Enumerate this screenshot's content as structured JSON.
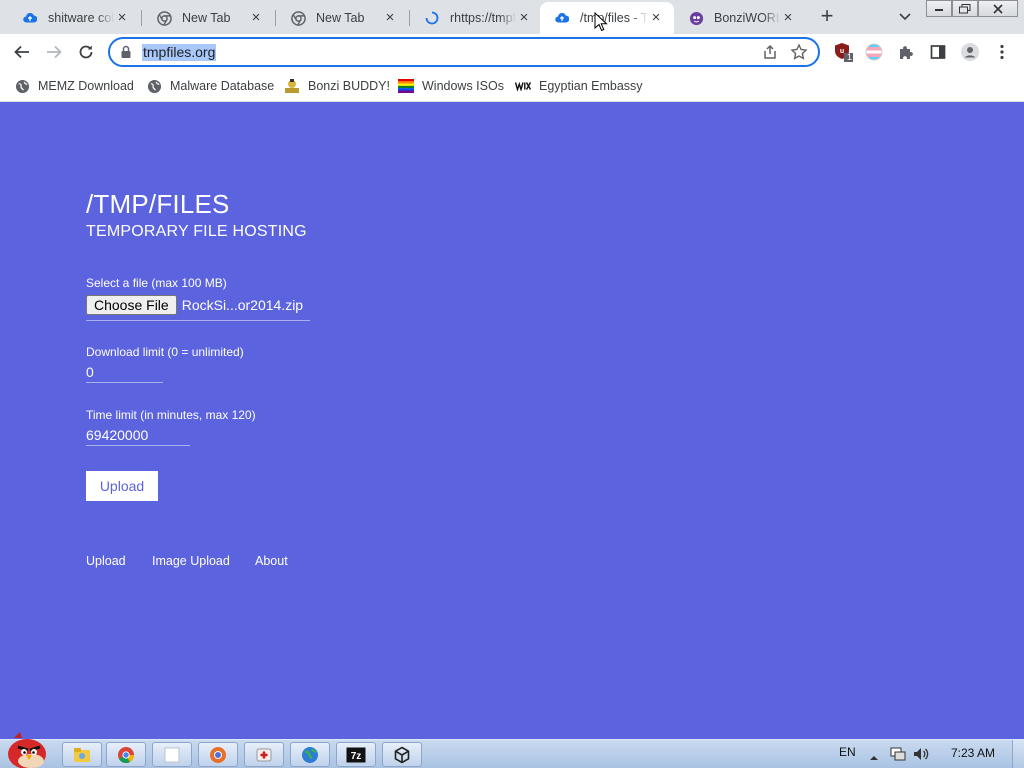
{
  "browser": {
    "tabs": [
      {
        "title": "shitware colle",
        "favicon": "cloud-upload-icon"
      },
      {
        "title": "New Tab",
        "favicon": "chrome-icon"
      },
      {
        "title": "New Tab",
        "favicon": "chrome-icon"
      },
      {
        "title": "rhttps://tmpfi",
        "favicon": "loading-spinner-icon"
      },
      {
        "title": "/tmp/files - T",
        "favicon": "cloud-upload-icon",
        "active": true
      },
      {
        "title": "BonziWORLD",
        "favicon": "bonzi-icon"
      }
    ],
    "new_tab_symbol": "+",
    "close_symbol": "×",
    "omnibox": {
      "url": "tmpfiles.org"
    },
    "bookmarks": [
      {
        "label": "MEMZ Download",
        "icon": "globe-icon"
      },
      {
        "label": "Malware Database",
        "icon": "globe-icon"
      },
      {
        "label": "Bonzi BUDDY!",
        "icon": "bonzi-icon"
      },
      {
        "label": "Windows ISOs",
        "icon": "rainbow-flag-icon"
      },
      {
        "label": "Egyptian Embassy",
        "icon": "wix-icon"
      }
    ],
    "extension_badge": "1",
    "accent_color": "#1a73e8"
  },
  "page": {
    "background_color": "#5b63df",
    "title": "/TMP/FILES",
    "subtitle": "TEMPORARY FILE HOSTING",
    "file_label": "Select a file (max 100 MB)",
    "choose_file_label": "Choose File",
    "file_name": "RockSi...or2014.zip",
    "download_limit_label": "Download limit (0 = unlimited)",
    "download_limit_value": "0",
    "time_limit_label": "Time limit (in minutes, max 120)",
    "time_limit_value": "69420000",
    "upload_button": "Upload",
    "footer_links": [
      "Upload",
      "Image Upload",
      "About"
    ]
  },
  "taskbar": {
    "language": "EN",
    "clock": "7:23 AM",
    "pinned": [
      "explorer-icon",
      "chrome-icon",
      "blank-window-icon",
      "chrome-alt-icon",
      "red-cross-icon",
      "globe-icon",
      "7zip-icon",
      "unity-icon"
    ]
  }
}
